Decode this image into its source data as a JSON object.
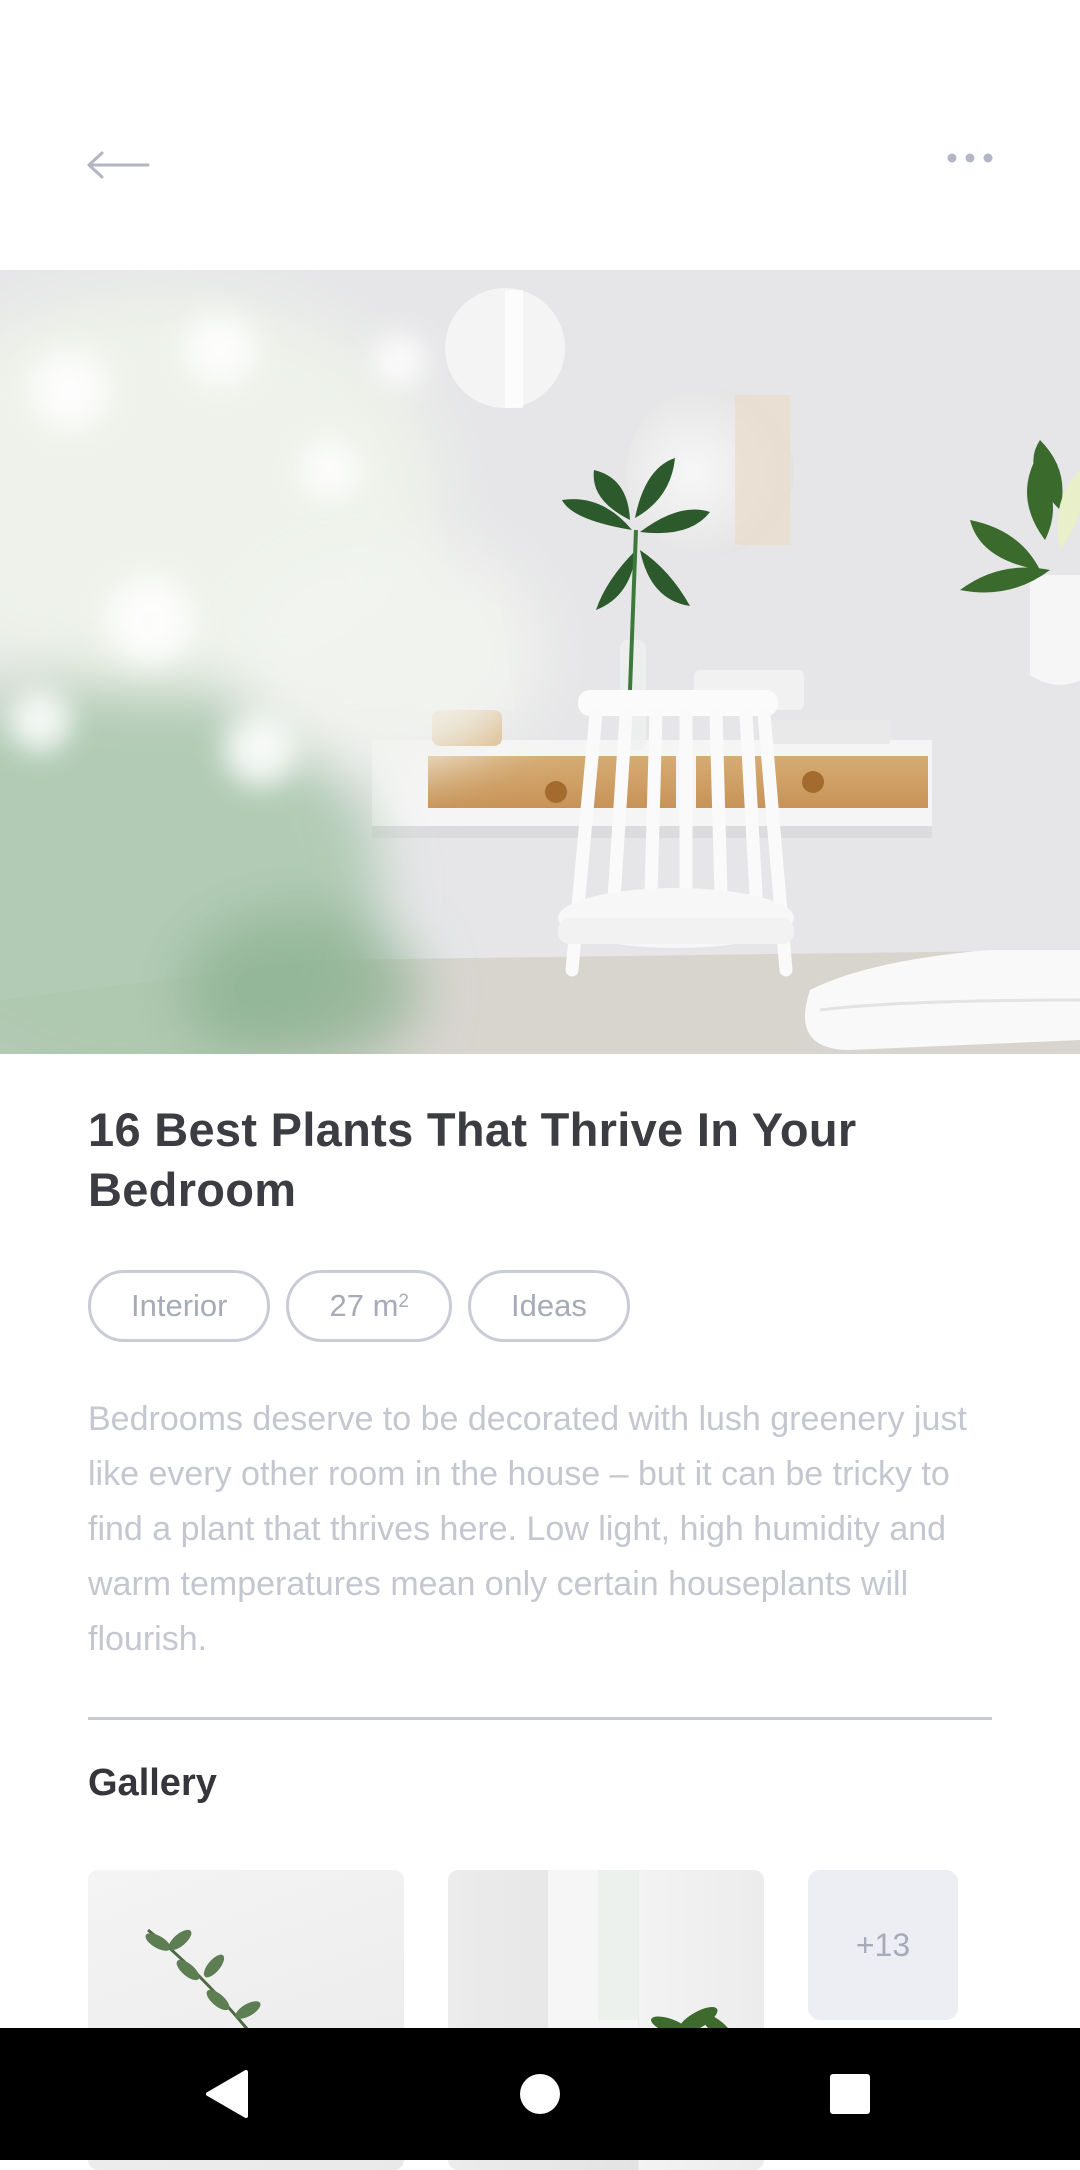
{
  "header": {
    "back_icon": "arrow-left-icon",
    "more_icon": "more-horizontal-icon"
  },
  "hero": {
    "image": "bedroom-photo"
  },
  "article": {
    "title": "16 Best Plants That Thrive In Your Bedroom",
    "tags": [
      {
        "label": "Interior"
      },
      {
        "label": "27 m",
        "superscript": "2"
      },
      {
        "label": "Ideas"
      }
    ],
    "description": "Bedrooms deserve to be decorated with lush greenery just like every other room in the house – but it can be tricky to find a plant that thrives here. Low light, high humidity and warm temperatures mean only certain houseplants will flourish."
  },
  "gallery": {
    "heading": "Gallery",
    "more_count": "+13"
  },
  "system_nav": {
    "back_icon": "triangle-back-icon",
    "home_icon": "circle-home-icon",
    "recents_icon": "square-recents-icon"
  },
  "colors": {
    "title": "#3c3c43",
    "tag_border": "#c9ccd6",
    "tag_text": "#a7abb8",
    "description": "#c4c7d0",
    "divider": "#c7cbd4",
    "more_tile_bg": "#eceef3"
  }
}
